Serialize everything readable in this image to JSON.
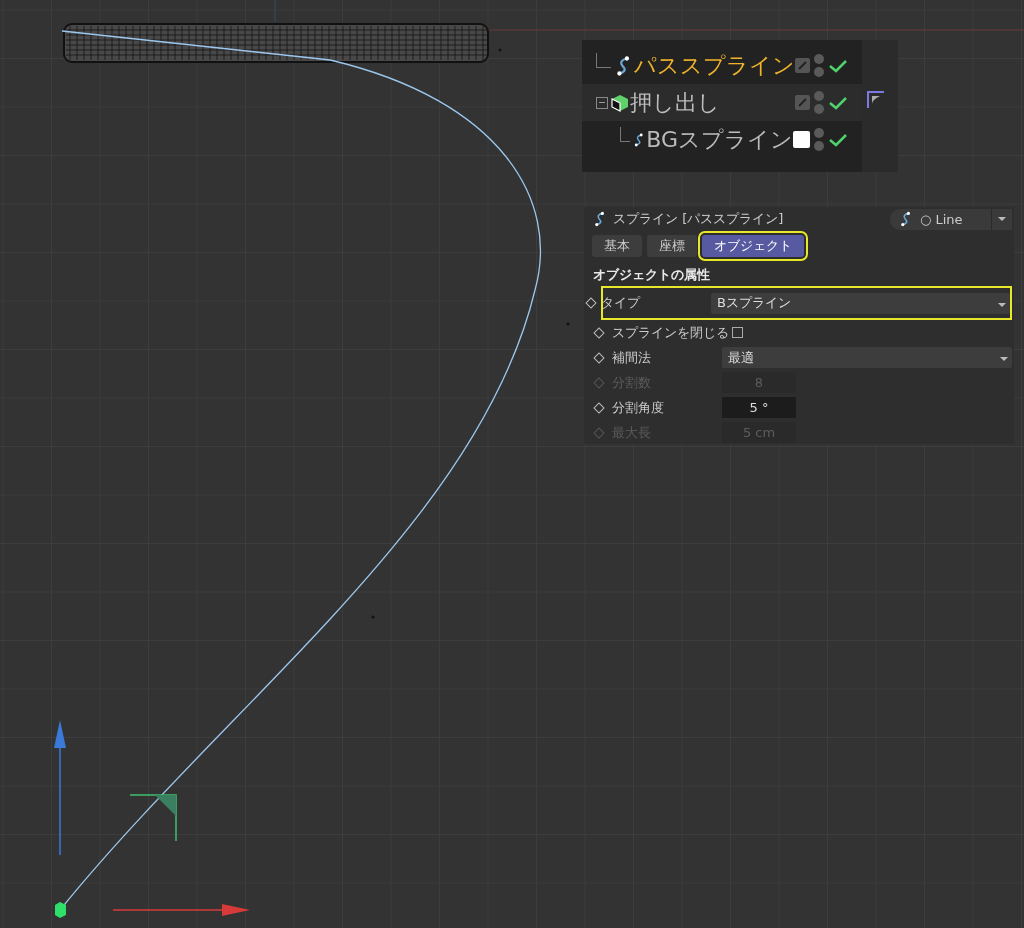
{
  "object_manager": {
    "items": [
      {
        "name": "パススプライン",
        "kind": "spline",
        "selected": true,
        "swatch": false,
        "enabled": true
      },
      {
        "name": "押し出し",
        "kind": "extrude",
        "selected": false,
        "swatch": false,
        "enabled": true,
        "expanded": true,
        "children": [
          {
            "name": "BGスプライン",
            "kind": "spline",
            "selected": false,
            "swatch": true,
            "enabled": true
          }
        ]
      }
    ]
  },
  "attribute_manager": {
    "title": "スプライン [パススプライン]",
    "mode": "○ Line",
    "tabs": [
      {
        "label": "基本",
        "selected": false,
        "highlighted": false
      },
      {
        "label": "座標",
        "selected": false,
        "highlighted": false
      },
      {
        "label": "オブジェクト",
        "selected": true,
        "highlighted": true
      }
    ],
    "section": "オブジェクトの属性",
    "rows": [
      {
        "kind": "dropdown",
        "label": "タイプ",
        "value": "Bスプライン",
        "disabled": false,
        "highlighted": true
      },
      {
        "kind": "checkbox",
        "label": "スプラインを閉じる",
        "checked": false,
        "disabled": false,
        "highlighted": false
      },
      {
        "kind": "dropdown",
        "label": "補間法",
        "value": "最適",
        "disabled": false,
        "highlighted": false
      },
      {
        "kind": "number",
        "label": "分割数",
        "value": "8",
        "disabled": true,
        "highlighted": false
      },
      {
        "kind": "number",
        "label": "分割角度",
        "value": "5 °",
        "disabled": false,
        "highlighted": false
      },
      {
        "kind": "number",
        "label": "最大長",
        "value": "5 cm",
        "disabled": true,
        "highlighted": false
      }
    ]
  }
}
